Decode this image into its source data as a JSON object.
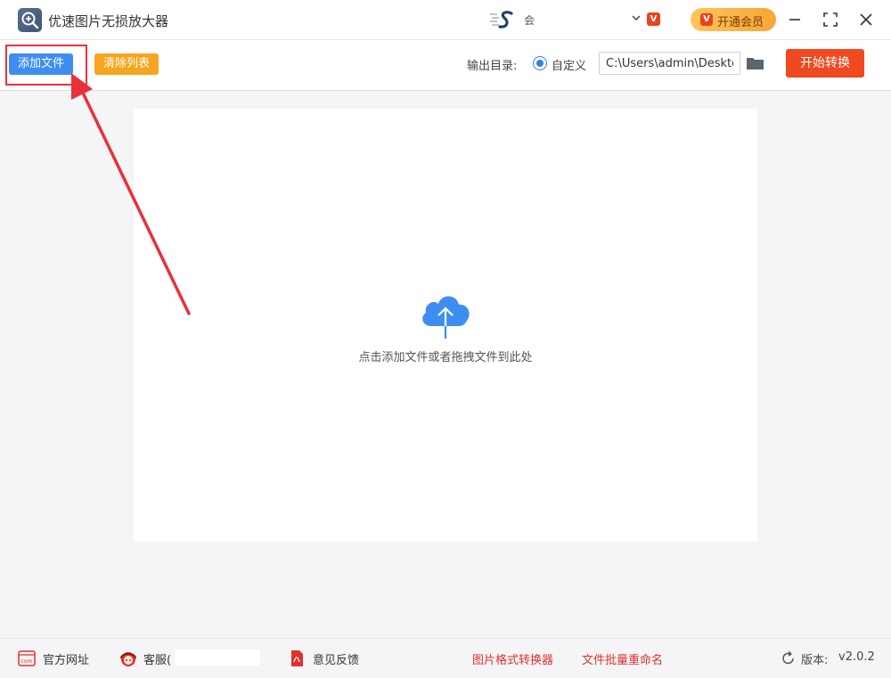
{
  "app": {
    "title": "优速图片无损放大器"
  },
  "account": {
    "name": "会",
    "vip_badge": "V"
  },
  "header": {
    "vip_button_label": "开通会员",
    "vip_icon_text": "V"
  },
  "toolbar": {
    "add_file": "添加文件",
    "clear_list": "清除列表",
    "output_label": "输出目录:",
    "custom_option": "自定义",
    "output_path": "C:\\Users\\admin\\Deskto",
    "start": "开始转换"
  },
  "dropzone": {
    "hint": "点击添加文件或者拖拽文件到此处"
  },
  "footer": {
    "website": "官方网址",
    "website_icon_text": "com",
    "service": "客服(",
    "feedback": "意见反馈",
    "format_converter": "图片格式转换器",
    "batch_rename": "文件批量重命名",
    "version_label": "版本:",
    "version_value": "v2.0.2"
  },
  "colors": {
    "primary_blue": "#3d8ef0",
    "clear_orange": "#f7a51e",
    "start_red": "#f0481f",
    "annotation_red": "#e8313a",
    "link_red": "#e0312a"
  },
  "icons": [
    "app-logo-icon",
    "user-logo-icon",
    "chevron-down-icon",
    "vip-icon",
    "minimize-icon",
    "maximize-icon",
    "close-icon",
    "folder-icon",
    "cloud-upload-icon",
    "web-icon",
    "service-avatar-icon",
    "pdf-icon",
    "refresh-icon"
  ]
}
